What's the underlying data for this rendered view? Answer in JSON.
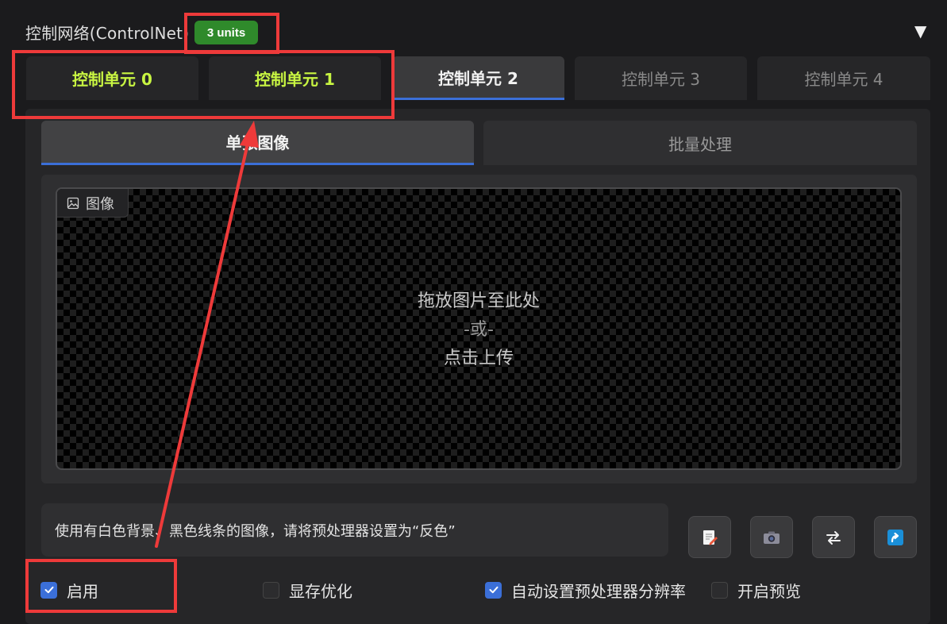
{
  "header": {
    "title": "控制网络(ControlNet)",
    "badge": "3 units",
    "collapse_icon": "▼"
  },
  "unit_tabs": [
    {
      "label": "控制单元 0",
      "state": "enabled"
    },
    {
      "label": "控制单元 1",
      "state": "enabled"
    },
    {
      "label": "控制单元 2",
      "state": "active"
    },
    {
      "label": "控制单元 3",
      "state": "idle"
    },
    {
      "label": "控制单元 4",
      "state": "idle"
    }
  ],
  "mode_tabs": [
    {
      "label": "单张图像",
      "state": "active"
    },
    {
      "label": "批量处理",
      "state": "idle"
    }
  ],
  "image": {
    "label": "图像",
    "drop_line1": "拖放图片至此处",
    "drop_line2": "-或-",
    "drop_line3": "点击上传"
  },
  "hint": "使用有白色背景、黑色线条的图像，请将预处理器设置为“反色”",
  "tools": [
    {
      "icon": "edit-note-icon"
    },
    {
      "icon": "camera-icon"
    },
    {
      "icon": "swap-arrows-icon"
    },
    {
      "icon": "send-up-arrow-icon"
    }
  ],
  "checkboxes": [
    {
      "label": "启用",
      "checked": true
    },
    {
      "label": "显存优化",
      "checked": false
    },
    {
      "label": "自动设置预处理器分辨率",
      "checked": true
    },
    {
      "label": "开启预览",
      "checked": false
    }
  ],
  "colors": {
    "accent_blue": "#3b6fd8",
    "enabled_tab_text": "#c8f542",
    "badge_green": "#2f8a2b",
    "annotation_red": "#ee3a3a"
  }
}
